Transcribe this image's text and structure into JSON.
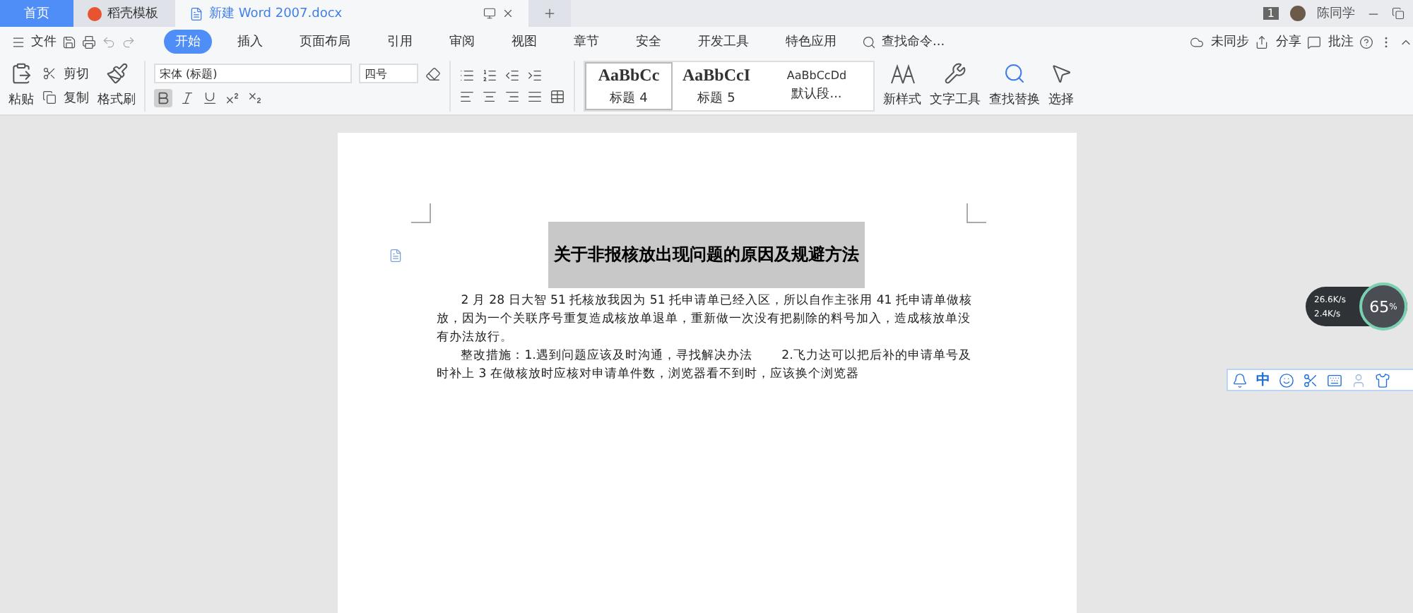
{
  "title_tabs": [
    {
      "label": "首页",
      "kind": "home",
      "selected": false
    },
    {
      "label": "稻壳模板",
      "kind": "template",
      "selected": false
    },
    {
      "label": "新建 Word 2007.docx",
      "kind": "doc",
      "selected": true
    }
  ],
  "title_right": {
    "badge": "1",
    "user": "陈同学"
  },
  "menu": {
    "file": "文件",
    "tabs": [
      {
        "label": "开始",
        "selected": true
      },
      {
        "label": "插入",
        "selected": false
      },
      {
        "label": "页面布局",
        "selected": false
      },
      {
        "label": "引用",
        "selected": false
      },
      {
        "label": "审阅",
        "selected": false
      },
      {
        "label": "视图",
        "selected": false
      },
      {
        "label": "章节",
        "selected": false
      },
      {
        "label": "安全",
        "selected": false
      },
      {
        "label": "开发工具",
        "selected": false
      },
      {
        "label": "特色应用",
        "selected": false
      }
    ],
    "search_placeholder": "查找命令...",
    "right": [
      "未同步",
      "分享",
      "批注"
    ]
  },
  "clipboard": {
    "paste": "粘贴",
    "cut": "剪切",
    "copy": "复制",
    "format_painter": "格式刷"
  },
  "font": {
    "name": "宋体 (标题)",
    "size": "四号",
    "bold": true
  },
  "styles": [
    {
      "sample": "AaBbCc",
      "label": "标题 4",
      "kind": "h4",
      "selected": true
    },
    {
      "sample": "AaBbCcI",
      "label": "标题 5",
      "kind": "h5",
      "selected": false
    },
    {
      "sample": "AaBbCcDd",
      "label": "默认段...",
      "kind": "normal",
      "selected": false
    }
  ],
  "big_buttons": [
    {
      "label": "新样式",
      "kind": "style"
    },
    {
      "label": "文字工具",
      "kind": "tool"
    },
    {
      "label": "查找替换",
      "kind": "find"
    },
    {
      "label": "选择",
      "kind": "select"
    }
  ],
  "document": {
    "title": "关于非报核放出现问题的原因及规避方法",
    "title_selected": true,
    "paragraphs": [
      "2 月 28 日大智 51 托核放我因为 51 托申请单已经入区，所以自作主张用 41 托申请单做核放，因为一个关联序号重复造成核放单退单，重新做一次没有把剔除的料号加入，造成核放单没有办法放行。",
      "整改措施：1.遇到问题应该及时沟通，寻找解决办法　　 2.飞力达可以把后补的申请单号及时补上 3 在做核放时应核对申请单件数，浏览器看不到时，应该换个浏览器"
    ]
  },
  "net_widget": {
    "up": "26.6K/s",
    "down": "2.4K/s",
    "percent": "65",
    "unit": "%"
  },
  "ime_bar": {
    "mode": "中"
  }
}
